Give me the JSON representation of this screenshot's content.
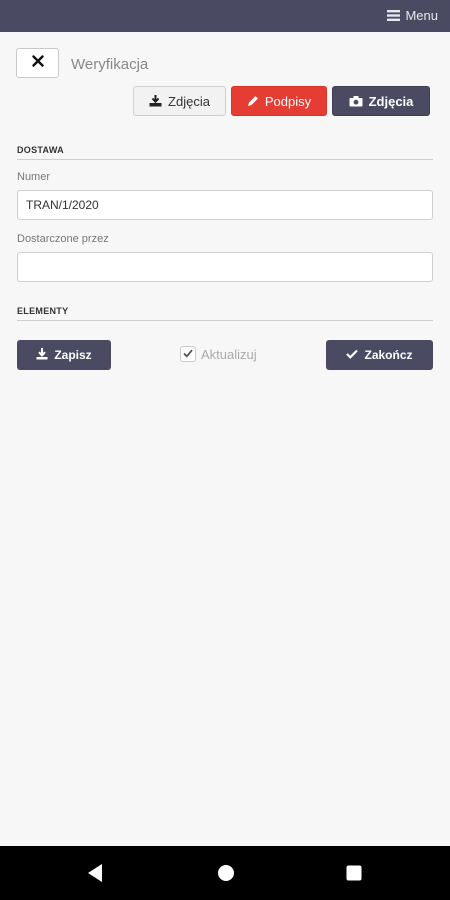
{
  "topbar": {
    "menu_label": "Menu",
    "background": "#4a4a62"
  },
  "header": {
    "title": "Weryfikacja",
    "close_icon": "x-icon"
  },
  "actions": {
    "photos_upload_label": "Zdjęcia",
    "signatures_label": "Podpisy",
    "photos_camera_label": "Zdjęcia"
  },
  "sections": {
    "delivery": "DOSTAWA",
    "items": "ELEMENTY"
  },
  "form": {
    "number_label": "Numer",
    "number_value": "TRAN/1/2020",
    "delivered_by_label": "Dostarczone przez",
    "delivered_by_value": ""
  },
  "controls": {
    "save_label": "Zapisz",
    "update_label": "Aktualizuj",
    "update_checked": true,
    "finish_label": "Zakończ"
  },
  "colors": {
    "accent": "#4a4a62",
    "danger": "#e53d33"
  }
}
